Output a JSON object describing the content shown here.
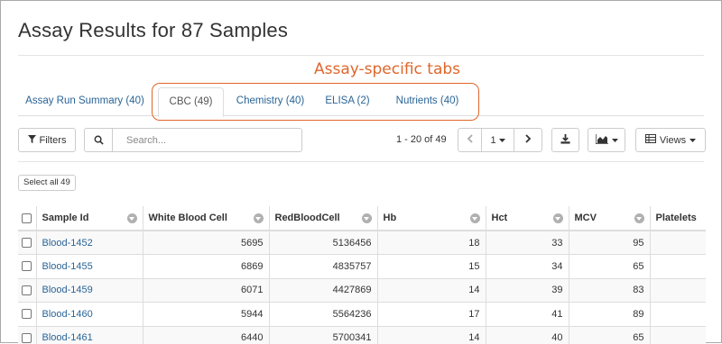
{
  "page": {
    "title": "Assay Results for 87 Samples",
    "annotation": "Assay-specific tabs"
  },
  "tabs": [
    {
      "label": "Assay Run Summary (40)",
      "active": false
    },
    {
      "label": "CBC (49)",
      "active": true
    },
    {
      "label": "Chemistry (40)",
      "active": false
    },
    {
      "label": "ELISA (2)",
      "active": false
    },
    {
      "label": "Nutrients (40)",
      "active": false
    }
  ],
  "toolbar": {
    "filters_label": "Filters",
    "search_placeholder": "Search...",
    "paging_text": "1 - 20 of 49",
    "current_page": "1",
    "views_label": "Views",
    "select_all_label": "Select all 49"
  },
  "grid": {
    "columns": [
      "Sample Id",
      "White Blood Cell",
      "RedBloodCell",
      "Hb",
      "Hct",
      "MCV",
      "Platelets"
    ],
    "rows": [
      {
        "sample_id": "Blood-1452",
        "wbc": "5695",
        "rbc": "5136456",
        "hb": "18",
        "hct": "33",
        "mcv": "95",
        "platelets": ""
      },
      {
        "sample_id": "Blood-1455",
        "wbc": "6869",
        "rbc": "4835757",
        "hb": "15",
        "hct": "34",
        "mcv": "65",
        "platelets": ""
      },
      {
        "sample_id": "Blood-1459",
        "wbc": "6071",
        "rbc": "4427869",
        "hb": "14",
        "hct": "39",
        "mcv": "83",
        "platelets": ""
      },
      {
        "sample_id": "Blood-1460",
        "wbc": "5944",
        "rbc": "5564236",
        "hb": "17",
        "hct": "41",
        "mcv": "89",
        "platelets": ""
      },
      {
        "sample_id": "Blood-1461",
        "wbc": "6440",
        "rbc": "5700341",
        "hb": "14",
        "hct": "40",
        "mcv": "65",
        "platelets": ""
      }
    ]
  },
  "colors": {
    "link": "#2a6496",
    "annotation": "#e0662a",
    "border": "#dddddd"
  }
}
